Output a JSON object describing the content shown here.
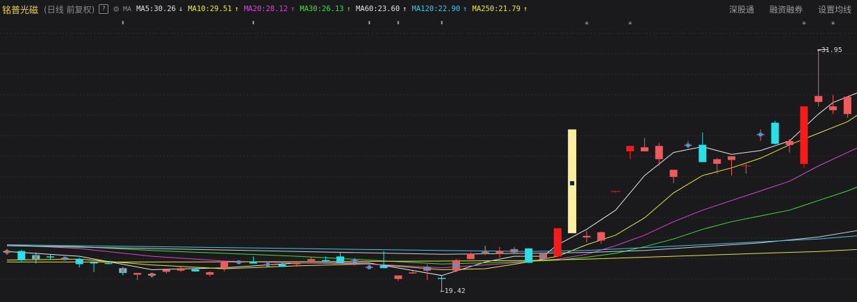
{
  "header": {
    "stock_name": "铭普光磁",
    "mode": "(日线 前复权)",
    "help": "?",
    "ma_label": "MA",
    "ma_items": [
      {
        "text": "MA5:30.26",
        "color": "#e0e0e0",
        "arrow": "↓",
        "arrow_color": "#e0e0e0"
      },
      {
        "text": "MA10:29.51",
        "color": "#e8e840",
        "arrow": "↑",
        "arrow_color": "#e8e840"
      },
      {
        "text": "MA20:28.12",
        "color": "#e040e0",
        "arrow": "↑",
        "arrow_color": "#e040e0"
      },
      {
        "text": "MA30:26.13",
        "color": "#40e040",
        "arrow": "↑",
        "arrow_color": "#40e040"
      },
      {
        "text": "MA60:23.60",
        "color": "#e0e0e0",
        "arrow": "↑",
        "arrow_color": "#e0e0e0"
      },
      {
        "text": "MA120:22.90",
        "color": "#40c8e8",
        "arrow": "↑",
        "arrow_color": "#40c8e8"
      },
      {
        "text": "MA250:21.79",
        "color": "#e8e840",
        "arrow": "↑",
        "arrow_color": "#e8e840"
      }
    ],
    "menu": [
      "深股通",
      "融资融券",
      "设置均线"
    ]
  },
  "chart_data": {
    "type": "candlestick",
    "ylim": [
      19.0,
      32.8
    ],
    "grid": true,
    "up_color": "#f05a5a",
    "down_color": "#28e0e8",
    "high_label": "31.95",
    "low_label": "19.42",
    "event_marks": [
      {
        "index": 8,
        "symbol": "⬍"
      },
      {
        "index": 17,
        "symbol": "⬍"
      },
      {
        "index": 25,
        "symbol": "⬍"
      },
      {
        "index": 27,
        "symbol": "⬍"
      },
      {
        "index": 30,
        "symbol": "⬍"
      },
      {
        "index": 40,
        "symbol": "✳"
      },
      {
        "index": 43,
        "symbol": "✳"
      },
      {
        "index": 55,
        "symbol": "✳"
      },
      {
        "index": 57,
        "symbol": "✳"
      }
    ],
    "candles": [
      {
        "o": 21.47,
        "h": 21.58,
        "l": 21.27,
        "c": 21.4,
        "hl": true
      },
      {
        "o": 21.47,
        "h": 21.54,
        "l": 20.92,
        "c": 20.99
      },
      {
        "o": 21.26,
        "h": 21.4,
        "l": 20.82,
        "c": 21.05,
        "hl": true
      },
      {
        "o": 21.19,
        "h": 21.3,
        "l": 21.05,
        "c": 21.14
      },
      {
        "o": 21.05,
        "h": 21.16,
        "l": 21.0,
        "c": 21.12,
        "hl": true
      },
      {
        "o": 21.06,
        "h": 21.12,
        "l": 20.62,
        "c": 20.79
      },
      {
        "o": 20.88,
        "h": 20.92,
        "l": 20.37,
        "c": 20.85
      },
      {
        "o": 20.85,
        "h": 20.92,
        "l": 20.78,
        "c": 20.81
      },
      {
        "o": 20.58,
        "h": 20.65,
        "l": 20.2,
        "c": 20.33,
        "hl": true
      },
      {
        "o": 20.24,
        "h": 20.33,
        "l": 19.96,
        "c": 20.33
      },
      {
        "o": 20.28,
        "h": 20.33,
        "l": 20.09,
        "c": 20.2,
        "hl": true
      },
      {
        "o": 20.39,
        "h": 20.48,
        "l": 20.29,
        "c": 20.5
      },
      {
        "o": 20.45,
        "h": 20.65,
        "l": 20.39,
        "c": 20.58
      },
      {
        "o": 20.52,
        "h": 20.58,
        "l": 20.39,
        "c": 20.41
      },
      {
        "o": 20.24,
        "h": 20.41,
        "l": 20.15,
        "c": 20.37
      },
      {
        "o": 20.58,
        "h": 20.92,
        "l": 20.41,
        "c": 20.92
      },
      {
        "o": 20.86,
        "h": 20.99,
        "l": 20.79,
        "c": 20.92,
        "hl": true
      },
      {
        "o": 20.92,
        "h": 21.19,
        "l": 20.82,
        "c": 20.82
      },
      {
        "o": 20.79,
        "h": 20.92,
        "l": 20.7,
        "c": 20.79,
        "hl": true
      },
      {
        "o": 20.77,
        "h": 20.88,
        "l": 20.65,
        "c": 20.65
      },
      {
        "o": 20.79,
        "h": 20.92,
        "l": 20.65,
        "c": 20.88
      },
      {
        "o": 20.96,
        "h": 21.16,
        "l": 20.85,
        "c": 21.05
      },
      {
        "o": 21.0,
        "h": 21.19,
        "l": 20.89,
        "c": 20.92
      },
      {
        "o": 21.19,
        "h": 21.4,
        "l": 20.99,
        "c": 20.88
      },
      {
        "o": 20.92,
        "h": 21.12,
        "l": 20.71,
        "c": 20.99,
        "hl": true
      },
      {
        "o": 20.65,
        "h": 20.79,
        "l": 20.53,
        "c": 20.65,
        "hl": true
      },
      {
        "o": 20.71,
        "h": 21.47,
        "l": 20.58,
        "c": 20.58
      },
      {
        "o": 20.02,
        "h": 20.2,
        "l": 19.92,
        "c": 20.2
      },
      {
        "o": 20.32,
        "h": 20.45,
        "l": 20.28,
        "c": 20.36
      },
      {
        "o": 20.45,
        "h": 20.79,
        "l": 19.96,
        "c": 20.65,
        "hl": true
      },
      {
        "o": 20.07,
        "h": 20.2,
        "l": 19.42,
        "c": 20.03
      },
      {
        "o": 20.45,
        "h": 21.05,
        "l": 20.37,
        "c": 21.0,
        "hl": true
      },
      {
        "o": 21.05,
        "h": 21.4,
        "l": 21.05,
        "c": 21.33
      },
      {
        "o": 21.43,
        "h": 21.75,
        "l": 21.26,
        "c": 21.4,
        "hl": true
      },
      {
        "o": 21.33,
        "h": 21.68,
        "l": 21.12,
        "c": 21.47
      },
      {
        "o": 21.4,
        "h": 21.68,
        "l": 21.37,
        "c": 21.57,
        "hl": true
      },
      {
        "o": 21.61,
        "h": 21.61,
        "l": 20.85,
        "c": 20.86
      },
      {
        "o": 21.05,
        "h": 21.26,
        "l": 20.92,
        "c": 21.33,
        "hl": true
      },
      {
        "o": 21.19,
        "h": 21.61,
        "l": 21.12,
        "c": 22.66,
        "solid": true
      },
      {
        "o": 25.08,
        "h": 25.08,
        "l": 24.38,
        "c": 24.38,
        "hl": true,
        "special": true
      },
      {
        "o": 22.18,
        "h": 22.52,
        "l": 21.92,
        "c": 22.26
      },
      {
        "o": 22.02,
        "h": 22.48,
        "l": 21.86,
        "c": 22.45
      },
      {
        "o": 24.57,
        "h": 24.57,
        "l": 24.52,
        "c": 24.57,
        "flat": true
      },
      {
        "o": 26.66,
        "h": 26.8,
        "l": 26.25,
        "c": 26.94,
        "solid": true
      },
      {
        "o": 26.66,
        "h": 27.36,
        "l": 26.66,
        "c": 26.87
      },
      {
        "o": 26.25,
        "h": 27.1,
        "l": 25.91,
        "c": 26.94
      },
      {
        "o": 25.33,
        "h": 25.7,
        "l": 25.0,
        "c": 25.7
      },
      {
        "o": 27.0,
        "h": 27.2,
        "l": 26.8,
        "c": 27.0,
        "hl": true
      },
      {
        "o": 27.0,
        "h": 27.64,
        "l": 26.31,
        "c": 26.1
      },
      {
        "o": 26.01,
        "h": 26.31,
        "l": 25.5,
        "c": 26.25
      },
      {
        "o": 26.21,
        "h": 26.4,
        "l": 25.4,
        "c": 26.4
      },
      {
        "o": 25.9,
        "h": 26.0,
        "l": 25.5,
        "c": 25.9,
        "flat": true
      },
      {
        "o": 27.56,
        "h": 27.8,
        "l": 27.2,
        "c": 27.56,
        "hl": true
      },
      {
        "o": 28.15,
        "h": 28.25,
        "l": 27.02,
        "c": 27.05
      },
      {
        "o": 26.99,
        "h": 27.3,
        "l": 26.6,
        "c": 27.2
      },
      {
        "o": 26.0,
        "h": 29.0,
        "l": 25.8,
        "c": 29.0,
        "solid": true
      },
      {
        "o": 29.23,
        "h": 31.95,
        "l": 29.0,
        "c": 29.54
      },
      {
        "o": 28.8,
        "h": 29.6,
        "l": 28.6,
        "c": 29.0
      },
      {
        "o": 28.6,
        "h": 29.45,
        "l": 28.4,
        "c": 29.5
      },
      {
        "o": 29.4,
        "h": 29.6,
        "l": 29.0,
        "c": 29.2
      },
      {
        "o": 28.82,
        "h": 29.4,
        "l": 28.5,
        "c": 28.9
      }
    ],
    "ma_lines": [
      {
        "name": "MA5",
        "color": "#e8e8e8",
        "pts": [
          [
            0,
            21.45
          ],
          [
            5,
            21.2
          ],
          [
            10,
            20.5
          ],
          [
            15,
            20.6
          ],
          [
            20,
            20.85
          ],
          [
            25,
            20.85
          ],
          [
            30,
            20.2
          ],
          [
            33,
            20.9
          ],
          [
            35,
            21.2
          ],
          [
            37,
            21.2
          ],
          [
            38,
            21.8
          ],
          [
            40,
            22.6
          ],
          [
            42,
            23.6
          ],
          [
            44,
            25.4
          ],
          [
            46,
            26.6
          ],
          [
            48,
            26.9
          ],
          [
            50,
            26.5
          ],
          [
            52,
            26.7
          ],
          [
            54,
            27.2
          ],
          [
            56,
            28.6
          ],
          [
            57,
            29.2
          ],
          [
            60,
            30.1
          ]
        ]
      },
      {
        "name": "MA10",
        "color": "#e8e840",
        "pts": [
          [
            0,
            21.0
          ],
          [
            5,
            21.05
          ],
          [
            10,
            20.75
          ],
          [
            15,
            20.55
          ],
          [
            20,
            20.7
          ],
          [
            25,
            20.8
          ],
          [
            30,
            20.5
          ],
          [
            33,
            20.55
          ],
          [
            36,
            20.9
          ],
          [
            38,
            21.2
          ],
          [
            40,
            21.8
          ],
          [
            42,
            22.3
          ],
          [
            44,
            23.2
          ],
          [
            46,
            24.5
          ],
          [
            48,
            25.4
          ],
          [
            50,
            25.8
          ],
          [
            52,
            26.3
          ],
          [
            54,
            27.0
          ],
          [
            56,
            27.6
          ],
          [
            58,
            28.2
          ],
          [
            60,
            29.2
          ]
        ]
      },
      {
        "name": "MA20",
        "color": "#e040e0",
        "pts": [
          [
            0,
            21.8
          ],
          [
            5,
            21.6
          ],
          [
            10,
            21.2
          ],
          [
            15,
            20.95
          ],
          [
            20,
            20.85
          ],
          [
            25,
            20.8
          ],
          [
            30,
            20.6
          ],
          [
            35,
            20.85
          ],
          [
            38,
            21.05
          ],
          [
            40,
            21.3
          ],
          [
            42,
            21.75
          ],
          [
            44,
            22.3
          ],
          [
            46,
            23.0
          ],
          [
            48,
            23.6
          ],
          [
            50,
            24.1
          ],
          [
            52,
            24.6
          ],
          [
            54,
            25.1
          ],
          [
            56,
            25.9
          ],
          [
            58,
            26.6
          ],
          [
            60,
            27.3
          ]
        ]
      },
      {
        "name": "MA30",
        "color": "#40e040",
        "pts": [
          [
            0,
            21.75
          ],
          [
            5,
            21.7
          ],
          [
            10,
            21.5
          ],
          [
            15,
            21.35
          ],
          [
            20,
            21.2
          ],
          [
            25,
            21.0
          ],
          [
            30,
            20.8
          ],
          [
            35,
            20.9
          ],
          [
            38,
            21.0
          ],
          [
            40,
            21.15
          ],
          [
            42,
            21.35
          ],
          [
            44,
            21.7
          ],
          [
            46,
            22.1
          ],
          [
            48,
            22.6
          ],
          [
            50,
            23.0
          ],
          [
            52,
            23.3
          ],
          [
            54,
            23.6
          ],
          [
            56,
            24.1
          ],
          [
            58,
            24.6
          ],
          [
            60,
            25.2
          ]
        ]
      },
      {
        "name": "MA60",
        "color": "#d0d0d0",
        "pts": [
          [
            0,
            21.75
          ],
          [
            10,
            21.6
          ],
          [
            20,
            21.45
          ],
          [
            30,
            21.3
          ],
          [
            36,
            21.35
          ],
          [
            40,
            21.4
          ],
          [
            44,
            21.5
          ],
          [
            48,
            21.7
          ],
          [
            52,
            21.9
          ],
          [
            56,
            22.2
          ],
          [
            60,
            22.7
          ]
        ]
      },
      {
        "name": "MA120",
        "color": "#40c8e8",
        "pts": [
          [
            0,
            21.8
          ],
          [
            10,
            21.7
          ],
          [
            20,
            21.6
          ],
          [
            30,
            21.5
          ],
          [
            36,
            21.45
          ],
          [
            40,
            21.5
          ],
          [
            44,
            21.65
          ],
          [
            48,
            21.8
          ],
          [
            52,
            21.95
          ],
          [
            56,
            22.1
          ],
          [
            60,
            22.35
          ]
        ]
      },
      {
        "name": "MA250",
        "color": "#e8e840",
        "pts": [
          [
            0,
            20.9
          ],
          [
            10,
            20.9
          ],
          [
            20,
            20.92
          ],
          [
            30,
            20.95
          ],
          [
            36,
            20.98
          ],
          [
            40,
            21.05
          ],
          [
            44,
            21.15
          ],
          [
            48,
            21.25
          ],
          [
            52,
            21.35
          ],
          [
            56,
            21.45
          ],
          [
            60,
            21.6
          ]
        ]
      }
    ]
  }
}
